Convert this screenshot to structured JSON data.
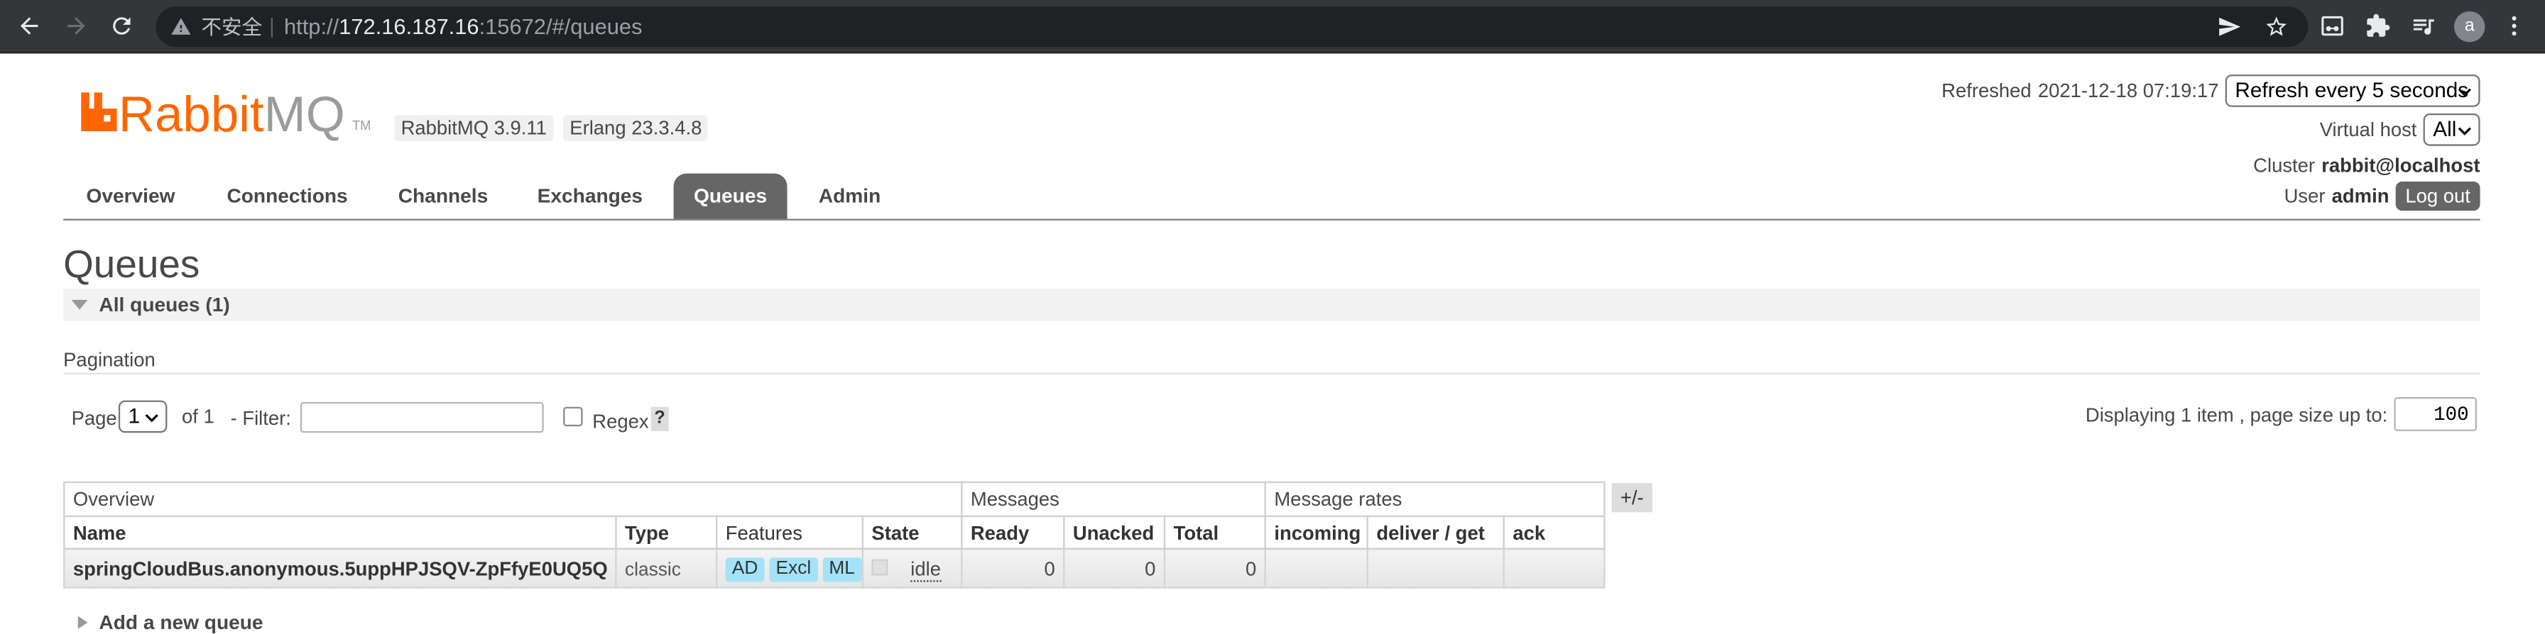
{
  "browser": {
    "security_label": "不安全",
    "url_scheme": "http://",
    "url_host": "172.16.187.16",
    "url_rest": ":15672/#/queues",
    "avatar_letter": "a",
    "icons": {
      "back": "arrow-left-icon",
      "forward": "arrow-right-icon",
      "reload": "reload-icon",
      "security": "warning-triangle-icon",
      "send": "send-icon",
      "bookmark": "star-icon",
      "extension_1": "glasses-box-icon",
      "extensions": "puzzle-piece-icon",
      "media": "queue-music-icon",
      "menu": "kebab-menu-icon"
    }
  },
  "header": {
    "logo": {
      "rabbit": "Rabbit",
      "mq": "MQ",
      "tm": "TM"
    },
    "version_badge": "RabbitMQ 3.9.11",
    "erlang_badge": "Erlang 23.3.4.8",
    "refreshed_label": "Refreshed",
    "refreshed_time": "2021-12-18 07:19:17",
    "refresh_select": "Refresh every 5 seconds",
    "vhost_label": "Virtual host",
    "vhost_select": "All",
    "cluster_label": "Cluster",
    "cluster_value": "rabbit@localhost",
    "user_label": "User",
    "user_value": "admin",
    "logout_label": "Log out"
  },
  "nav": {
    "tabs": [
      {
        "label": "Overview",
        "active": false
      },
      {
        "label": "Connections",
        "active": false
      },
      {
        "label": "Channels",
        "active": false
      },
      {
        "label": "Exchanges",
        "active": false
      },
      {
        "label": "Queues",
        "active": true
      },
      {
        "label": "Admin",
        "active": false
      }
    ]
  },
  "page": {
    "title": "Queues",
    "section_title": "All queues (1)",
    "pagination": {
      "label": "Pagination",
      "page_label": "Page",
      "page_value": "1",
      "of_label": "of 1",
      "filter_label": "- Filter:",
      "regex_label": "Regex",
      "regex_checked": false,
      "help": "?",
      "displaying": "Displaying 1 item , page size up to:",
      "page_size": "100"
    },
    "table": {
      "groups": [
        "Overview",
        "Messages",
        "Message rates"
      ],
      "toggle": "+/-",
      "columns": [
        "Name",
        "Type",
        "Features",
        "State",
        "Ready",
        "Unacked",
        "Total",
        "incoming",
        "deliver / get",
        "ack"
      ],
      "rows": [
        {
          "name": "springCloudBus.anonymous.5uppHPJSQV-ZpFfyE0UQ5Q",
          "type": "classic",
          "features": [
            "AD",
            "Excl",
            "ML"
          ],
          "state": "idle",
          "ready": "0",
          "unacked": "0",
          "total": "0"
        }
      ]
    },
    "add_queue": "Add a new queue"
  },
  "colors": {
    "brand_orange": "#ff6600",
    "logo_gray": "#9b9b9b",
    "active_tab": "#666666",
    "feature_badge": "#a3e3f7",
    "logout_button": "#666666",
    "browser_toolbar": "#35363a"
  }
}
